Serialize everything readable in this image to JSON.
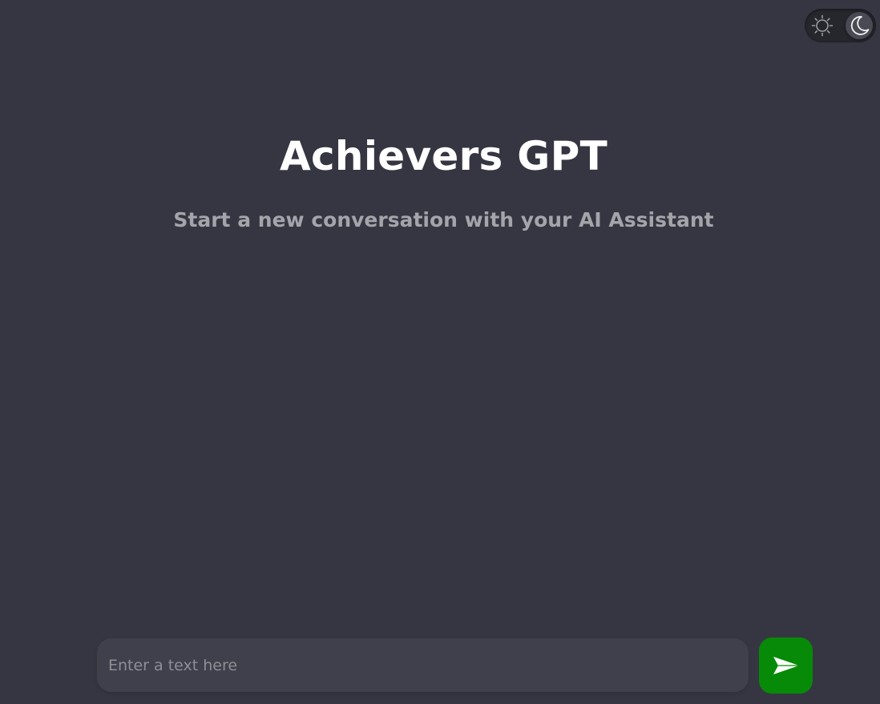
{
  "header": {
    "title": "Achievers GPT",
    "subtitle": "Start a new conversation with your AI Assistant"
  },
  "theme_toggle": {
    "light_icon": "sun-icon",
    "dark_icon": "moon-icon",
    "active": "dark"
  },
  "composer": {
    "input_value": "",
    "placeholder": "Enter a text here",
    "send_icon": "send-icon",
    "send_color": "#078a07"
  },
  "colors": {
    "background": "#363642",
    "input_background": "#40404c",
    "accent": "#078a07"
  }
}
